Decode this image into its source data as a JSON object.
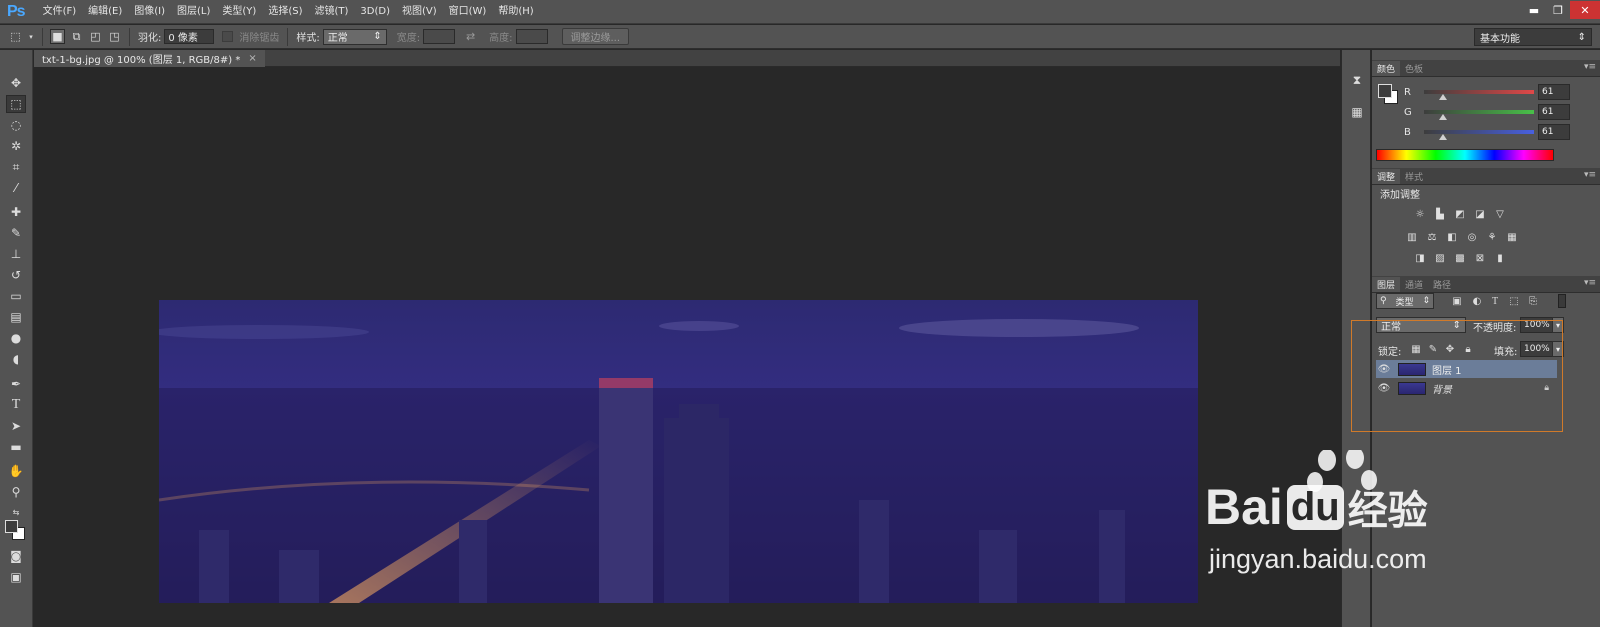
{
  "app": {
    "logo": "Ps"
  },
  "menu": [
    "文件(F)",
    "编辑(E)",
    "图像(I)",
    "图层(L)",
    "类型(Y)",
    "选择(S)",
    "滤镜(T)",
    "3D(D)",
    "视图(V)",
    "窗口(W)",
    "帮助(H)"
  ],
  "window_controls": {
    "minimize": "▬",
    "restore": "❐",
    "close": "✕"
  },
  "options": {
    "feather_label": "羽化:",
    "feather_value": "0 像素",
    "antialias_label": "消除锯齿",
    "style_label": "样式:",
    "style_value": "正常",
    "width_label": "宽度:",
    "height_label": "高度:",
    "refine_edge": "调整边缘...",
    "workspace": "基本功能"
  },
  "document": {
    "tab_title": "txt-1-bg.jpg @ 100% (图层 1, RGB/8#) *",
    "close": "×"
  },
  "color_panel": {
    "tabs": [
      "颜色",
      "色板"
    ],
    "channels": [
      {
        "label": "R",
        "value": "61",
        "color": "#e04848"
      },
      {
        "label": "G",
        "value": "61",
        "color": "#48c048"
      },
      {
        "label": "B",
        "value": "61",
        "color": "#4860e0"
      }
    ]
  },
  "adjust_panel": {
    "tabs": [
      "调整",
      "样式"
    ],
    "title": "添加调整"
  },
  "layers_panel": {
    "tabs": [
      "图层",
      "通道",
      "路径"
    ],
    "filter_kind": "类型",
    "blend_mode": "正常",
    "opacity_label": "不透明度:",
    "opacity_value": "100%",
    "lock_label": "锁定:",
    "fill_label": "填充:",
    "fill_value": "100%",
    "layers": [
      {
        "name": "图层 1",
        "selected": true
      },
      {
        "name": "背景",
        "selected": false,
        "locked": true
      }
    ]
  },
  "watermark": {
    "brand": "Bai",
    "brand2": "du",
    "suffix": "经验",
    "url": "jingyan.baidu.com"
  },
  "colors": {
    "accent": "#4aa8ff",
    "highlight_box": "#d07a2a",
    "selected_layer": "#6b7d99",
    "night_image": "#2f2a78"
  }
}
